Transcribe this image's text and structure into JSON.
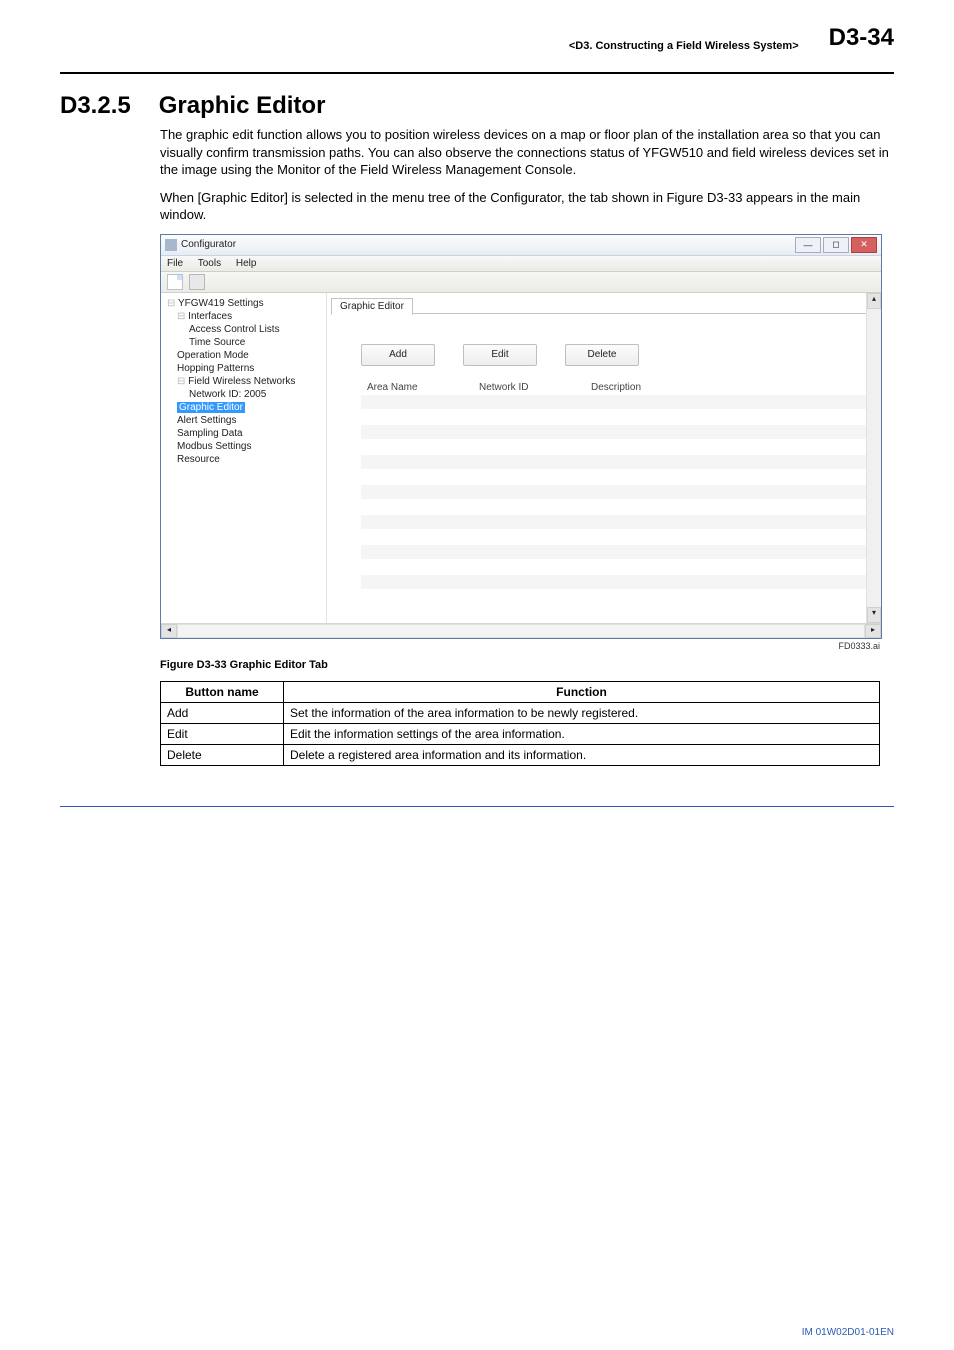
{
  "header": {
    "chapter": "<D3.  Constructing a Field Wireless System>",
    "page": "D3-34"
  },
  "section": {
    "number": "D3.2.5",
    "title": "Graphic Editor"
  },
  "paragraphs": {
    "p1": "The graphic edit function allows you to position wireless devices on a map or floor plan of the installation area so that you can visually confirm transmission paths. You can also observe the connections status of YFGW510 and field wireless devices set in the image using the Monitor of the Field Wireless Management Console.",
    "p2": "When [Graphic Editor] is selected in the menu tree of the Configurator, the tab shown in Figure D3-33 appears in the main window."
  },
  "configurator": {
    "title": "Configurator",
    "menu": {
      "file": "File",
      "tools": "Tools",
      "help": "Help"
    },
    "tree": {
      "root": "YFGW419 Settings",
      "interfaces": "Interfaces",
      "acl": "Access Control Lists",
      "time": "Time Source",
      "opmode": "Operation Mode",
      "hopping": "Hopping Patterns",
      "fwn": "Field Wireless Networks",
      "nid": "Network ID: 2005",
      "graphic": "Graphic Editor",
      "alert": "Alert Settings",
      "sampling": "Sampling Data",
      "modbus": "Modbus Settings",
      "resource": "Resource"
    },
    "tab": "Graphic Editor",
    "buttons": {
      "add": "Add",
      "edit": "Edit",
      "delete": "Delete"
    },
    "columns": {
      "area": "Area Name",
      "net": "Network ID",
      "desc": "Description"
    }
  },
  "figure": {
    "id": "FD0333.ai",
    "caption": "Figure D3-33  Graphic Editor Tab"
  },
  "table": {
    "head": {
      "name": "Button name",
      "func": "Function"
    },
    "rows": [
      {
        "name": "Add",
        "func": "Set the information of the area information to be newly registered."
      },
      {
        "name": "Edit",
        "func": "Edit the information settings of the area information."
      },
      {
        "name": "Delete",
        "func": "Delete a registered area information and its information."
      }
    ]
  },
  "footer": {
    "doc": "IM 01W02D01-01EN"
  }
}
